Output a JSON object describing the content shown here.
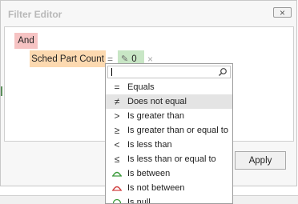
{
  "window": {
    "title": "Filter Editor",
    "close_symbol": "×"
  },
  "filter": {
    "group_operator": "And",
    "field": "Sched Part Count",
    "operator_symbol": "=",
    "value": "0",
    "remove_symbol": "×"
  },
  "apply_label": "Apply",
  "dropdown": {
    "search_value": "",
    "items": [
      {
        "label": "Equals",
        "icon": "equals-icon",
        "glyph": "=",
        "selected": false
      },
      {
        "label": "Does not equal",
        "icon": "not-equal-icon",
        "glyph": "≠",
        "selected": true
      },
      {
        "label": "Is greater than",
        "icon": "greater-than-icon",
        "glyph": ">",
        "selected": false
      },
      {
        "label": "Is greater than or equal to",
        "icon": "greater-or-equal-icon",
        "glyph": "≥",
        "selected": false
      },
      {
        "label": "Is less than",
        "icon": "less-than-icon",
        "glyph": "<",
        "selected": false
      },
      {
        "label": "Is less than or equal to",
        "icon": "less-or-equal-icon",
        "glyph": "≤",
        "selected": false
      },
      {
        "label": "Is between",
        "icon": "between-icon",
        "glyph": "",
        "selected": false
      },
      {
        "label": "Is not between",
        "icon": "not-between-icon",
        "glyph": "",
        "selected": false
      },
      {
        "label": "Is null",
        "icon": "is-null-icon",
        "glyph": "",
        "selected": false
      }
    ]
  },
  "colors": {
    "group_pill": "#f6c3c3",
    "field_pill": "#fcd9b0",
    "value_pill": "#c8e6c5",
    "between_green": "#3a9a3a",
    "not_between_red": "#d04040"
  }
}
